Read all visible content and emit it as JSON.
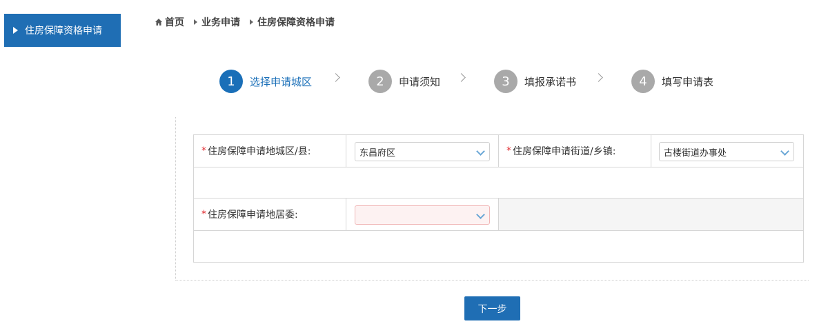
{
  "sidebar": {
    "tab_label": "住房保障资格申请"
  },
  "breadcrumb": {
    "home": "首页",
    "level1": "业务申请",
    "level2": "住房保障资格申请"
  },
  "steps": [
    {
      "num": "1",
      "label": "选择申请城区"
    },
    {
      "num": "2",
      "label": "申请须知"
    },
    {
      "num": "3",
      "label": "填报承诺书"
    },
    {
      "num": "4",
      "label": "填写申请表"
    }
  ],
  "form": {
    "district_label": "住房保障申请地城区/县:",
    "district_value": "东昌府区",
    "street_label": "住房保障申请街道/乡镇:",
    "street_value": "古楼街道办事处",
    "committee_label": "住房保障申请地居委:",
    "committee_value": "",
    "required_mark": "*"
  },
  "buttons": {
    "next_label": "下一步"
  },
  "colors": {
    "primary": "#1f6eb4",
    "inactive_step": "#a9a9a9",
    "required": "#e0252a"
  }
}
